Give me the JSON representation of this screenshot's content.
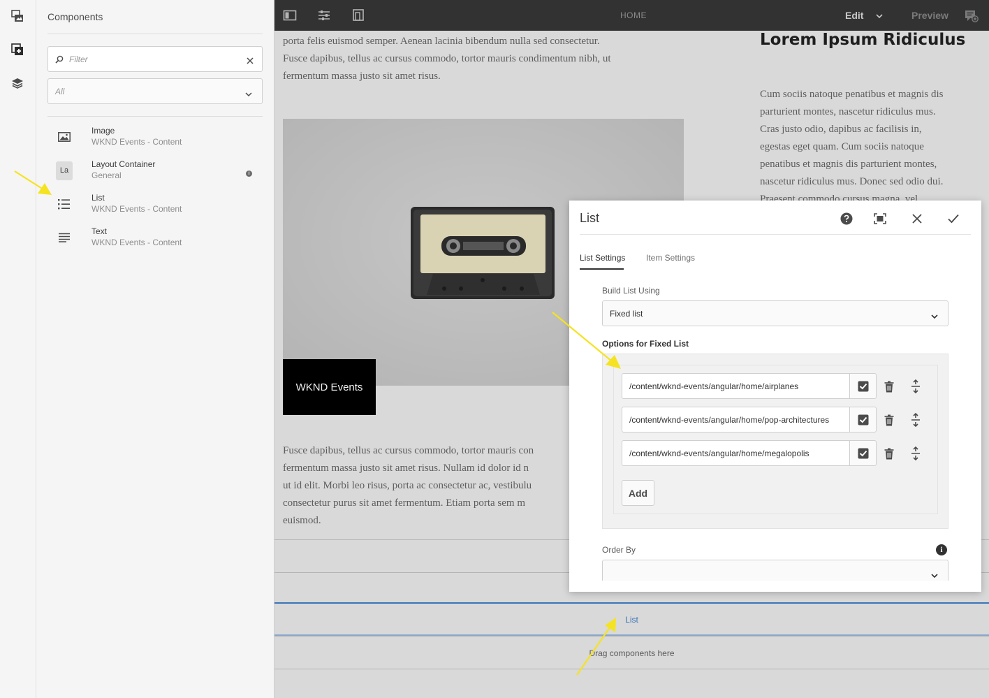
{
  "panel": {
    "title": "Components",
    "filter_placeholder": "Filter",
    "group_value": "All",
    "items": [
      {
        "name": "Image",
        "group": "WKND Events - Content",
        "icon": "image-icon"
      },
      {
        "name": "Layout Container",
        "group": "General",
        "icon": "layout-container-badge",
        "badge": "La"
      },
      {
        "name": "List",
        "group": "WKND Events - Content",
        "icon": "list-icon"
      },
      {
        "name": "Text",
        "group": "WKND Events - Content",
        "icon": "text-icon"
      }
    ]
  },
  "topbar": {
    "title": "HOME",
    "mode": "Edit",
    "preview": "Preview"
  },
  "page": {
    "intro_lines": [
      "porta felis euismod semper. Aenean lacinia bibendum nulla sed consectetur.",
      "Fusce dapibus, tellus ac cursus commodo, tortor mauris condimentum nibh, ut",
      "fermentum massa justo sit amet risus."
    ],
    "hero_badge": "WKND Events",
    "body_lines": [
      "Fusce dapibus, tellus ac cursus commodo, tortor mauris con",
      "fermentum massa justo sit amet risus. Nullam id dolor id n",
      "ut id elit. Morbi leo risus, porta ac consectetur ac, vestibulu",
      "consectetur purus sit amet fermentum. Etiam porta sem m",
      "euismod."
    ],
    "side_title": "Lorem Ipsum Ridiculus",
    "side_lines": [
      "Cum sociis natoque penatibus et magnis dis",
      "parturient montes, nascetur ridiculus mus.",
      "Cras justo odio, dapibus ac facilisis in,",
      "egestas eget quam. Cum sociis natoque",
      "penatibus et magnis dis parturient montes,",
      "nascetur ridiculus mus. Donec sed odio dui.",
      "Praesent commodo cursus magna, vel"
    ],
    "dropzone_1": "Drag components here",
    "list_component": "List",
    "dropzone_2": "Drag components here"
  },
  "dialog": {
    "title": "List",
    "tabs": [
      "List Settings",
      "Item Settings"
    ],
    "build_label": "Build List Using",
    "build_value": "Fixed list",
    "options_label": "Options for Fixed List",
    "pages": [
      "/content/wknd-events/angular/home/airplanes",
      "/content/wknd-events/angular/home/pop-architectures",
      "/content/wknd-events/angular/home/megalopolis"
    ],
    "add_label": "Add",
    "order_label": "Order By",
    "order_value": ""
  },
  "colors": {
    "topbar": "#323232",
    "accent": "#3b74b7",
    "arrow": "#f5e321"
  }
}
